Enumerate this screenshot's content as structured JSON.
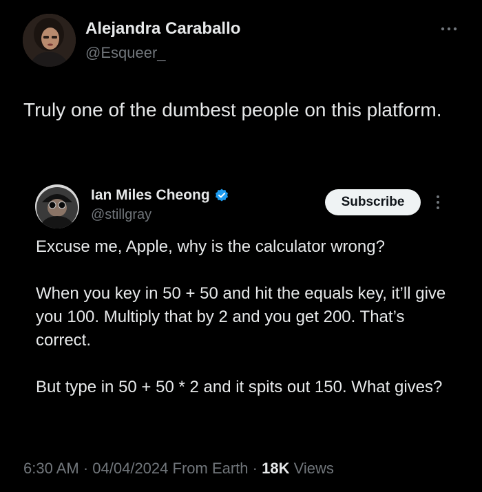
{
  "colors": {
    "background": "#000000",
    "text_primary": "#e7e9ea",
    "text_secondary": "#71767b",
    "verified_blue": "#1d9bf0",
    "subscribe_bg": "#eff3f4"
  },
  "author": {
    "name": "Alejandra Caraballo",
    "handle": "@Esqueer_",
    "avatar_icon": "profile-photo"
  },
  "more_icon": "more-horizontal-icon",
  "tweet": {
    "text": "Truly one of the dumbest people on this platform."
  },
  "quoted": {
    "name": "Ian Miles Cheong",
    "verified_icon": "verified-badge-icon",
    "handle": "@stillgray",
    "subscribe_label": "Subscribe",
    "more_icon": "more-vertical-icon",
    "paragraphs": [
      "Excuse me, Apple, why is the calculator wrong?",
      "When you key in 50 + 50 and hit the equals key, it’ll give you 100. Multiply that by 2 and you get 200. That’s correct.",
      "But type in 50 + 50 * 2 and it spits out 150. What gives?"
    ]
  },
  "meta": {
    "time": "6:30 AM",
    "separator": " · ",
    "date": "04/04/2024",
    "source": " From Earth",
    "views_count": "18K",
    "views_label": " Views"
  }
}
